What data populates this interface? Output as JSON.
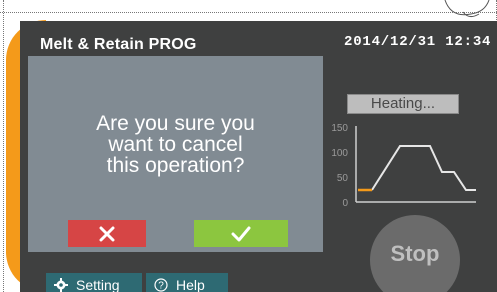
{
  "header": {
    "title": "Melt & Retain PROG",
    "datetime": "2014/12/31 12:34"
  },
  "dialog": {
    "message_line1": "Are you sure you",
    "message_line2": "want to cancel",
    "message_line3": "this operation?",
    "cancel_icon": "x-icon",
    "confirm_icon": "check-icon"
  },
  "status": {
    "label": "Heating..."
  },
  "graph": {
    "y_ticks": [
      "150",
      "100",
      "50",
      "0"
    ]
  },
  "controls": {
    "stop_label": "Stop"
  },
  "tabs": [
    {
      "label": "Setting",
      "icon": "gear-icon"
    },
    {
      "label": "Help",
      "icon": "help-icon"
    }
  ],
  "colors": {
    "screen_bg": "#3f4040",
    "dialog_bg": "#818b93",
    "accent_orange": "#f49a1a",
    "cancel_red": "#d64545",
    "confirm_green": "#8cc63f",
    "tab_teal": "#2e6a73"
  }
}
